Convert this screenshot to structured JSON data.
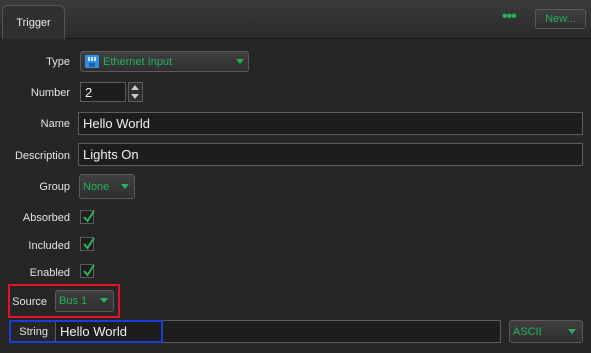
{
  "header": {
    "tab_label": "Trigger",
    "more_icon": "ellipsis-icon",
    "new_button_label": "New..."
  },
  "type": {
    "label": "Type",
    "icon": "ethernet-icon",
    "value": "Ethernet Input"
  },
  "number": {
    "label": "Number",
    "value": "2"
  },
  "name": {
    "label": "Name",
    "value": "Hello World"
  },
  "description": {
    "label": "Description",
    "value": "Lights On"
  },
  "group": {
    "label": "Group",
    "value": "None"
  },
  "absorbed": {
    "label": "Absorbed",
    "checked": true
  },
  "included": {
    "label": "Included",
    "checked": true
  },
  "enabled": {
    "label": "Enabled",
    "checked": true
  },
  "source": {
    "label": "Source",
    "value": "Bus 1"
  },
  "string": {
    "label": "String",
    "value": "Hello World",
    "encoding": "ASCII"
  },
  "colors": {
    "accent_green": "#25b55b",
    "highlight_red": "#e2141c",
    "highlight_blue": "#1a3fd6"
  }
}
